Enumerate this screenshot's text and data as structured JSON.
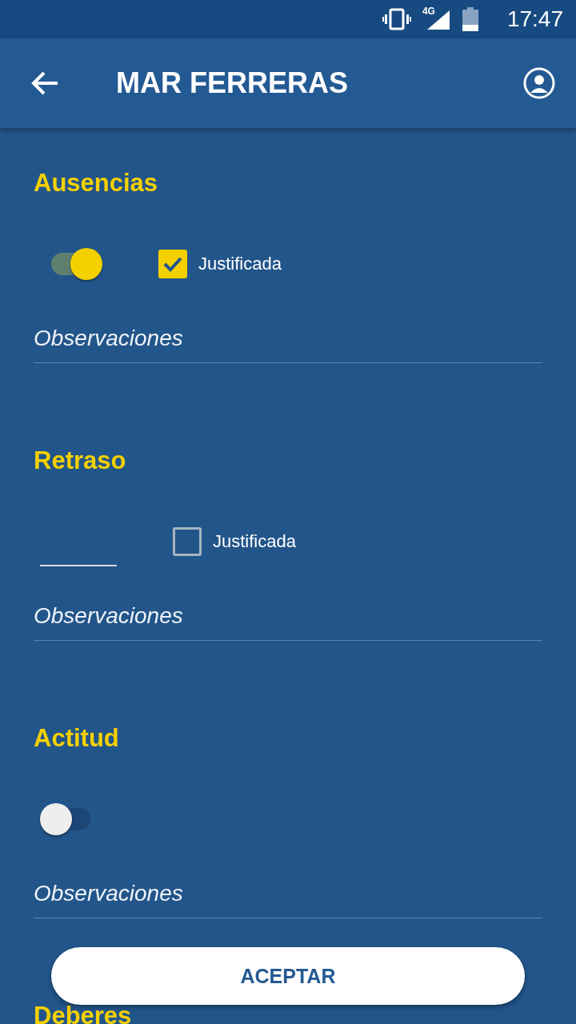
{
  "status_bar": {
    "network": "4G",
    "time": "17:47"
  },
  "app_bar": {
    "title": "MAR FERRERAS"
  },
  "sections": [
    {
      "title": "Ausencias",
      "control": {
        "kind": "switch",
        "on": true
      },
      "justified": {
        "label": "Justificada",
        "checked": true
      },
      "notes": {
        "placeholder": "Observaciones"
      }
    },
    {
      "title": "Retraso",
      "control": {
        "kind": "field"
      },
      "justified": {
        "label": "Justificada",
        "checked": false
      },
      "notes": {
        "placeholder": "Observaciones"
      }
    },
    {
      "title": "Actitud",
      "control": {
        "kind": "switch",
        "on": false
      },
      "notes": {
        "placeholder": "Observaciones"
      }
    },
    {
      "title": "Deberes"
    }
  ],
  "accept_button": {
    "label": "ACEPTAR"
  }
}
